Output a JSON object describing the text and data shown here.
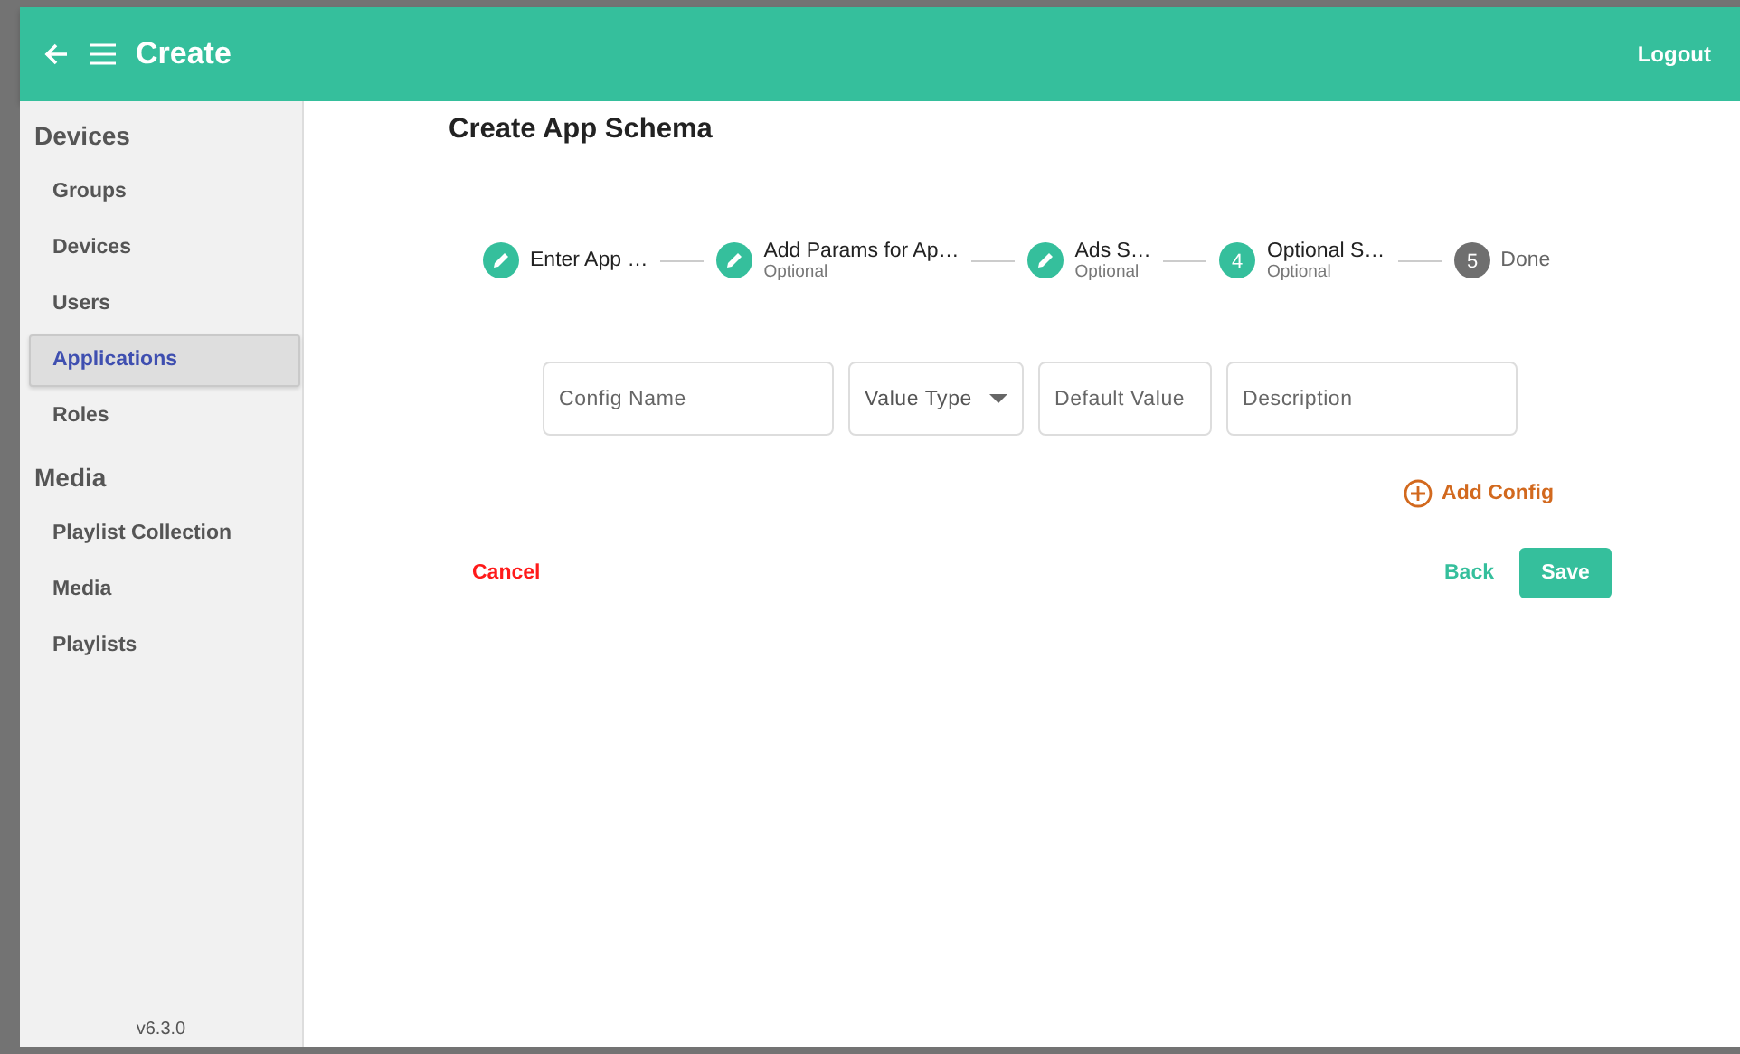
{
  "header": {
    "title": "Create",
    "logout": "Logout"
  },
  "sidebar": {
    "sections": [
      {
        "heading": "Devices",
        "items": [
          {
            "label": "Groups",
            "selected": false
          },
          {
            "label": "Devices",
            "selected": false
          },
          {
            "label": "Users",
            "selected": false
          },
          {
            "label": "Applications",
            "selected": true
          },
          {
            "label": "Roles",
            "selected": false
          }
        ]
      },
      {
        "heading": "Media",
        "items": [
          {
            "label": "Playlist Collection",
            "selected": false
          },
          {
            "label": "Media",
            "selected": false
          },
          {
            "label": "Playlists",
            "selected": false
          }
        ]
      }
    ],
    "version": "v6.3.0"
  },
  "page": {
    "title": "Create App Schema"
  },
  "steps": [
    {
      "kind": "done",
      "label": "Enter App …"
    },
    {
      "kind": "done",
      "label": "Add Params for Ap…",
      "optional": "Optional"
    },
    {
      "kind": "done",
      "label": "Ads S…",
      "optional": "Optional"
    },
    {
      "kind": "active",
      "number": "4",
      "label": "Optional S…",
      "optional": "Optional"
    },
    {
      "kind": "pending",
      "number": "5",
      "label": "Done"
    }
  ],
  "fields": [
    {
      "kind": "text",
      "placeholder": "Config Name"
    },
    {
      "kind": "select",
      "placeholder": "Value Type"
    },
    {
      "kind": "text",
      "placeholder": "Default Value"
    },
    {
      "kind": "text",
      "placeholder": "Description"
    }
  ],
  "add_config": "Add Config",
  "actions": {
    "cancel": "Cancel",
    "back": "Back",
    "save": "Save"
  }
}
